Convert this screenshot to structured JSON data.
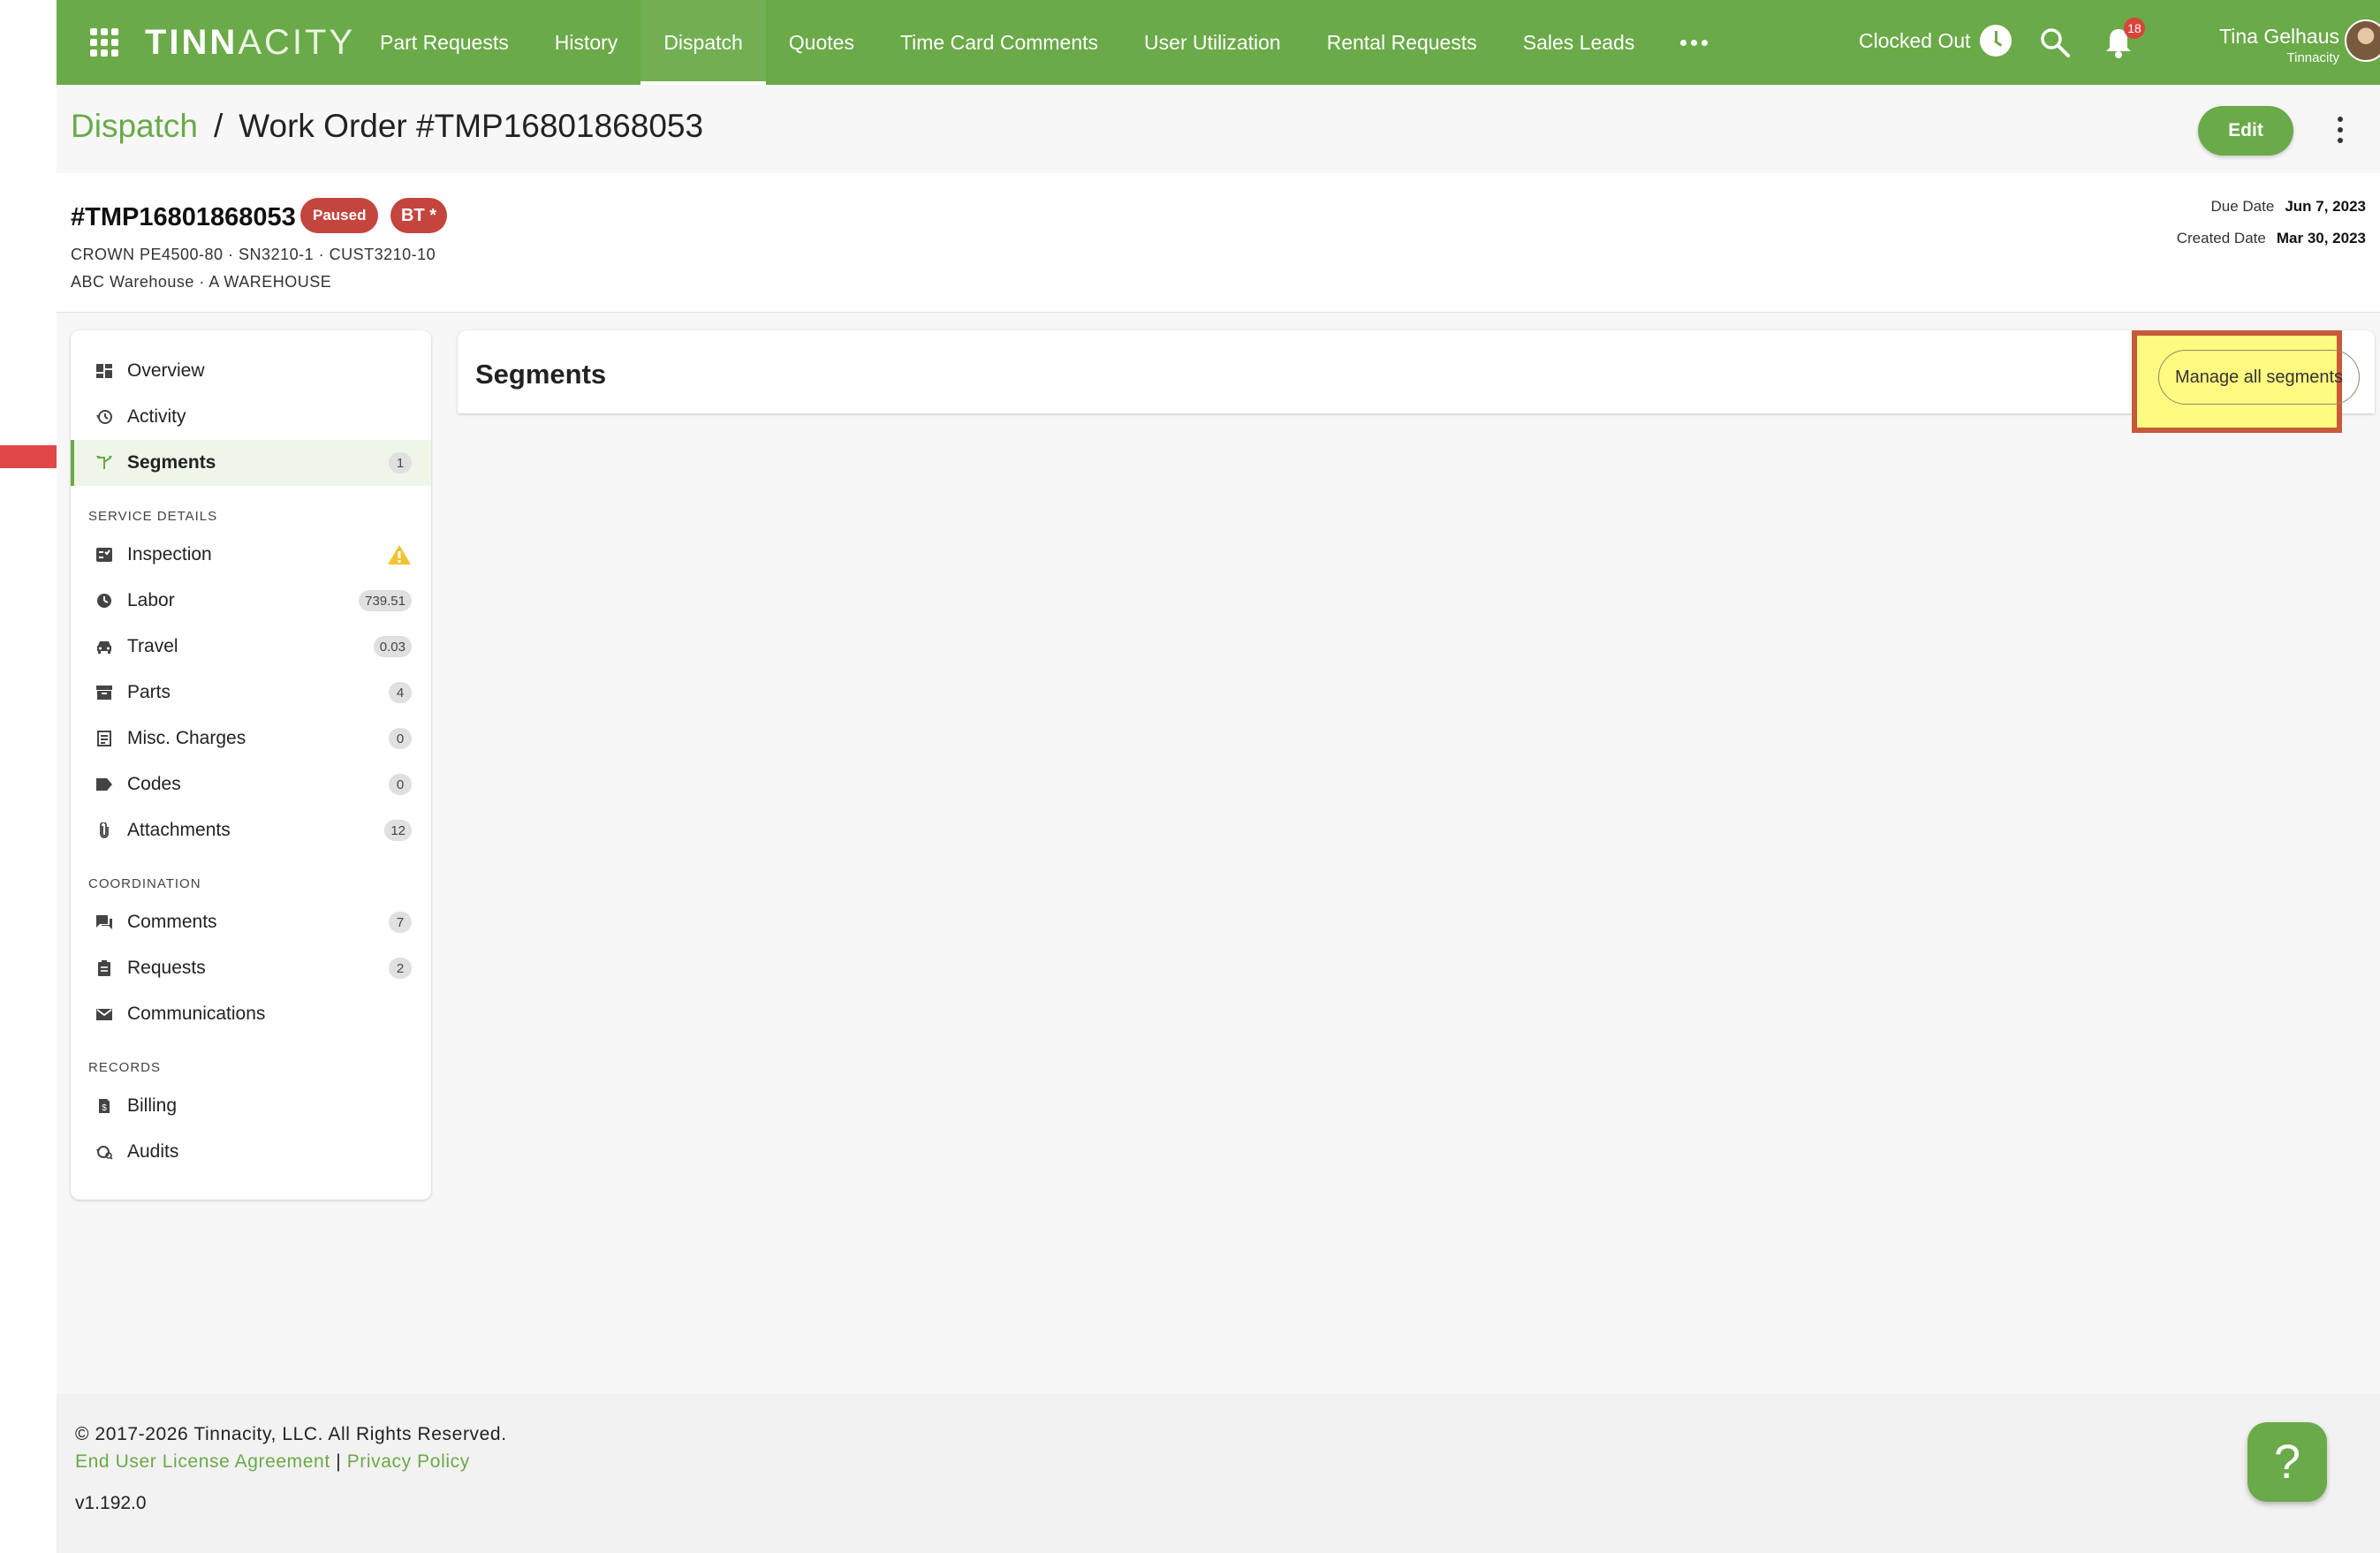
{
  "brand": {
    "logo_text_a": "TINN",
    "logo_text_b": "ACITY",
    "accent": "#6aaa48",
    "danger": "#c4453e"
  },
  "nav": {
    "items": [
      {
        "label": "Part Requests",
        "active": false
      },
      {
        "label": "History",
        "active": false
      },
      {
        "label": "Dispatch",
        "active": true
      },
      {
        "label": "Quotes",
        "active": false
      },
      {
        "label": "Time Card Comments",
        "active": false
      },
      {
        "label": "User Utilization",
        "active": false
      },
      {
        "label": "Rental Requests",
        "active": false
      },
      {
        "label": "Sales Leads",
        "active": false
      }
    ],
    "more_icon": "more-horizontal-icon"
  },
  "header_right": {
    "clock_status": "Clocked Out",
    "notification_count": "18",
    "user_name": "Tina Gelhaus",
    "user_org": "Tinnacity"
  },
  "breadcrumb": {
    "parent": "Dispatch",
    "separator": "/",
    "current": "Work Order #TMP16801868053"
  },
  "actions": {
    "edit_label": "Edit"
  },
  "work_order": {
    "id": "#TMP16801868053",
    "status": "Paused",
    "tag": "BT *",
    "equipment_line": "CROWN PE4500-80 · SN3210-1 · CUST3210-10",
    "location_line": "ABC Warehouse · A WAREHOUSE",
    "due_date_label": "Due Date",
    "due_date": "Jun 7, 2023",
    "created_date_label": "Created Date",
    "created_date": "Mar 30, 2023"
  },
  "sidebar": {
    "top_items": [
      {
        "label": "Overview",
        "icon": "dashboard-icon"
      },
      {
        "label": "Activity",
        "icon": "history-icon"
      },
      {
        "label": "Segments",
        "icon": "segments-icon",
        "count": "1",
        "active": true
      }
    ],
    "service_details_title": "SERVICE DETAILS",
    "service_items": [
      {
        "label": "Inspection",
        "icon": "checklist-icon",
        "warning": true
      },
      {
        "label": "Labor",
        "icon": "clock-icon",
        "count": "739.51"
      },
      {
        "label": "Travel",
        "icon": "car-icon",
        "count": "0.03"
      },
      {
        "label": "Parts",
        "icon": "archive-icon",
        "count": "4"
      },
      {
        "label": "Misc. Charges",
        "icon": "receipt-icon",
        "count": "0"
      },
      {
        "label": "Codes",
        "icon": "tag-icon",
        "count": "0"
      },
      {
        "label": "Attachments",
        "icon": "paperclip-icon",
        "count": "12"
      }
    ],
    "coordination_title": "COORDINATION",
    "coordination_items": [
      {
        "label": "Comments",
        "icon": "comments-icon",
        "count": "7"
      },
      {
        "label": "Requests",
        "icon": "clipboard-icon",
        "count": "2"
      },
      {
        "label": "Communications",
        "icon": "mail-icon"
      }
    ],
    "records_title": "RECORDS",
    "records_items": [
      {
        "label": "Billing",
        "icon": "billing-icon"
      },
      {
        "label": "Audits",
        "icon": "audit-icon"
      }
    ]
  },
  "segments_panel": {
    "title": "Segments",
    "manage_label": "Manage all segments"
  },
  "footer": {
    "copyright": "© 2017-2026 Tinnacity, LLC. All Rights Reserved.",
    "eula": "End User License Agreement",
    "divider": "|",
    "privacy": "Privacy Policy",
    "version": "v1.192.0",
    "help": "?"
  }
}
